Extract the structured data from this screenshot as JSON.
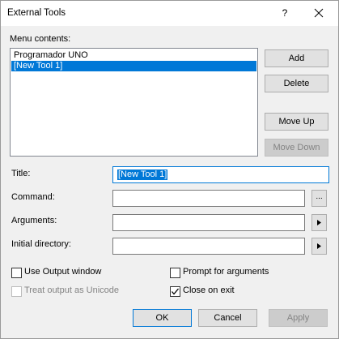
{
  "window": {
    "title": "External Tools",
    "help_label": "?"
  },
  "menu_contents": {
    "label": "Menu contents:",
    "items": [
      {
        "label": "Programador UNO",
        "selected": false
      },
      {
        "label": "[New Tool 1]",
        "selected": true
      }
    ]
  },
  "side_buttons": {
    "add": "Add",
    "delete": "Delete",
    "move_up": "Move Up",
    "move_down": "Move Down"
  },
  "fields": {
    "title_label": "Title:",
    "title_value": "[New Tool 1]",
    "command_label": "Command:",
    "command_value": "",
    "command_browse": "...",
    "arguments_label": "Arguments:",
    "arguments_value": "",
    "initial_directory_label": "Initial directory:",
    "initial_directory_value": ""
  },
  "options": {
    "use_output_window": {
      "label": "Use Output window",
      "checked": false
    },
    "prompt_for_arguments": {
      "label": "Prompt for arguments",
      "checked": false
    },
    "treat_output_unicode": {
      "label": "Treat output as Unicode",
      "checked": false,
      "enabled": false
    },
    "close_on_exit": {
      "label": "Close on exit",
      "checked": true
    }
  },
  "footer": {
    "ok": "OK",
    "cancel": "Cancel",
    "apply": "Apply"
  },
  "colors": {
    "accent": "#0078d7",
    "dialog_bg": "#f0f0f0",
    "button_bg": "#e1e1e1"
  }
}
